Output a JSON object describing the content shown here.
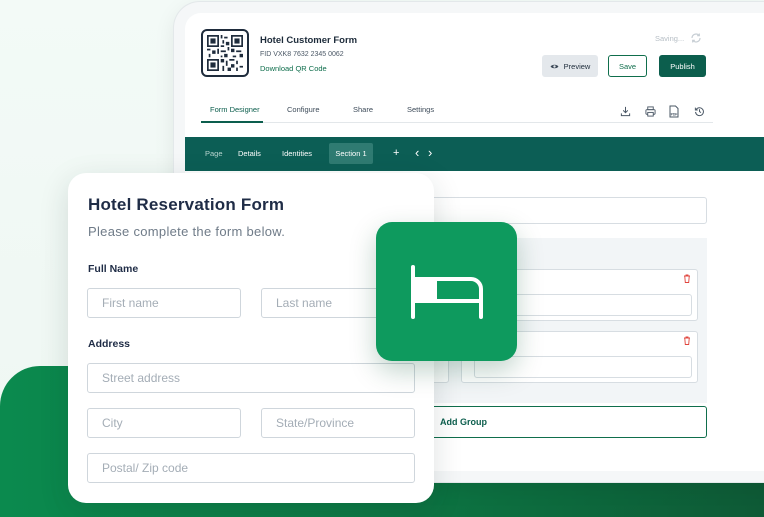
{
  "header": {
    "form_title": "Hotel Customer Form",
    "fid": "FID VXK8 7632 2345 0062",
    "qr_link": "Download QR Code",
    "saving_status": "Saving...",
    "preview_label": "Preview",
    "save_label": "Save",
    "publish_label": "Publish"
  },
  "tabs": [
    {
      "label": "Form Designer",
      "active": true
    },
    {
      "label": "Configure",
      "active": false
    },
    {
      "label": "Share",
      "active": false
    },
    {
      "label": "Settings",
      "active": false
    }
  ],
  "toolbar_icons": [
    "download-icon",
    "print-icon",
    "pdf-icon",
    "history-icon"
  ],
  "pdf_icon_text": "PDF",
  "subbar": {
    "page_label": "Page",
    "items": [
      "Details",
      "Identities"
    ],
    "active_section": "Section 1",
    "add_symbol": "+",
    "prev_symbol": "‹",
    "next_symbol": "›"
  },
  "canvas": {
    "address_label_partial": "ss",
    "add_group_label": "Add Group"
  },
  "reservation_form": {
    "title": "Hotel Reservation Form",
    "subtitle": "Please complete the form below.",
    "full_name_label": "Full Name",
    "first_name_placeholder": "First name",
    "last_name_placeholder": "Last name",
    "address_label": "Address",
    "street_placeholder": "Street address",
    "city_placeholder": "City",
    "state_placeholder": "State/Province",
    "postal_placeholder": "Postal/ Zip code"
  },
  "colors": {
    "brand_dark": "#0c5e55",
    "brand_green": "#0e9a5e",
    "danger": "#e0443c"
  }
}
